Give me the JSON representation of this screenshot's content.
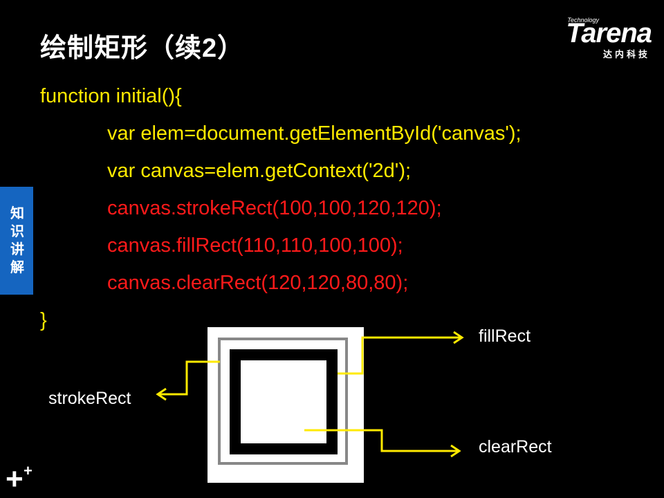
{
  "slide": {
    "title": "绘制矩形（续2）"
  },
  "logo": {
    "small_text": "Technology",
    "brand": "Tarena",
    "sub": "达内科技"
  },
  "side_tab": {
    "label": "知识讲解"
  },
  "code": {
    "line1": "function initial(){",
    "line2": "var elem=document.getElementById('canvas');",
    "line3": "var canvas=elem.getContext('2d');",
    "line4": "canvas.strokeRect(100,100,120,120);",
    "line5": "canvas.fillRect(110,110,100,100);",
    "line6": "canvas.clearRect(120,120,80,80);",
    "line7": "}"
  },
  "diagram": {
    "label_fill": "fillRect",
    "label_stroke": "strokeRect",
    "label_clear": "clearRect"
  },
  "colors": {
    "code_text": "#ffea00",
    "code_highlight": "#ff1a1a",
    "side_tab": "#1565c0",
    "arrow": "#ffea00"
  },
  "icons": {
    "bottom_left": "plus-icon"
  }
}
